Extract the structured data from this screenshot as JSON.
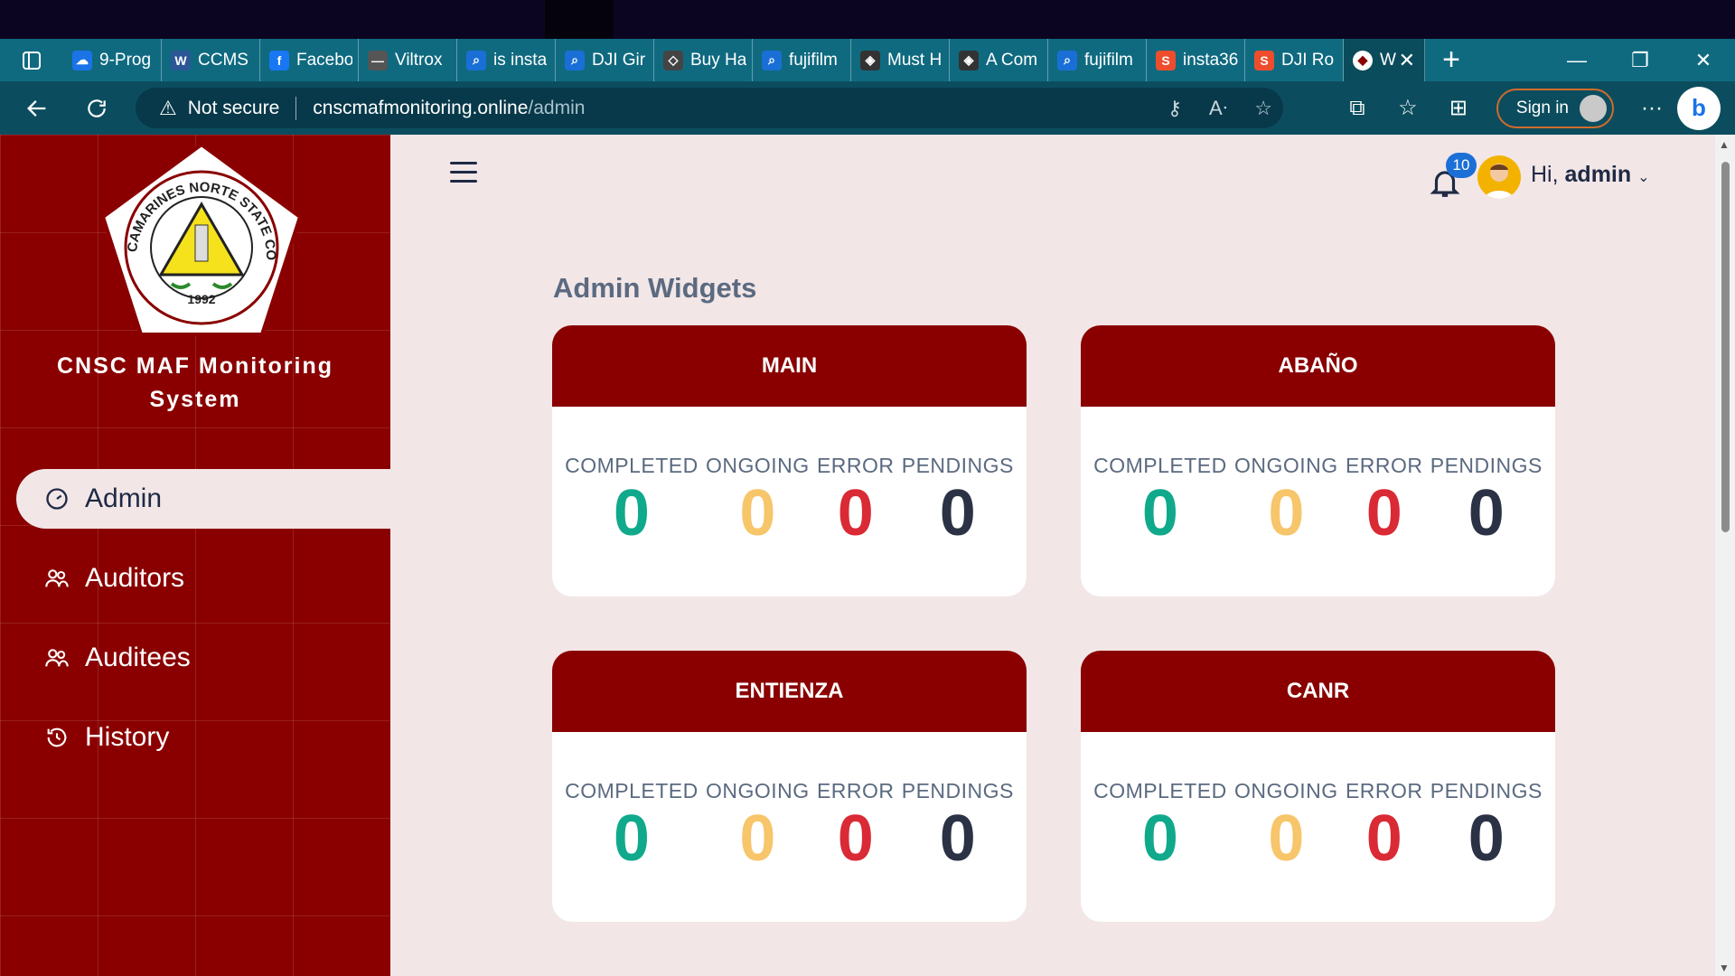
{
  "browser": {
    "tabs": [
      {
        "label": "9-Prog",
        "icon": "onedrive-icon",
        "color": "#1b73e8"
      },
      {
        "label": "CCMS",
        "icon": "word-icon",
        "color": "#2b5797"
      },
      {
        "label": "Facebo",
        "icon": "facebook-icon",
        "color": "#1877f2"
      },
      {
        "label": "Viltrox",
        "icon": "dash-icon",
        "color": "#555555"
      },
      {
        "label": "is insta",
        "icon": "search-icon",
        "color": "#1a6fd6"
      },
      {
        "label": "DJI Gir",
        "icon": "search-icon",
        "color": "#1a6fd6"
      },
      {
        "label": "Buy Ha",
        "icon": "dji-icon",
        "color": "#444444"
      },
      {
        "label": "fujifilm",
        "icon": "search-icon",
        "color": "#1a6fd6"
      },
      {
        "label": "Must H",
        "icon": "diamond-icon",
        "color": "#333333"
      },
      {
        "label": "A Com",
        "icon": "diamond-icon",
        "color": "#333333"
      },
      {
        "label": "fujifilm",
        "icon": "search-icon",
        "color": "#1a6fd6"
      },
      {
        "label": "insta36",
        "icon": "shopee-icon",
        "color": "#ee4d2d"
      },
      {
        "label": "DJI Ro",
        "icon": "shopee-icon",
        "color": "#ee4d2d"
      }
    ],
    "active_tab": {
      "label": "W",
      "icon": "college-seal-icon"
    },
    "address": {
      "security": "Not secure",
      "host": "cnscmafmonitoring.online",
      "path": "/admin"
    },
    "signin_label": "Sign in"
  },
  "sidebar": {
    "brand_line1": "CNSC MAF Monitoring",
    "brand_line2": "System",
    "logo": {
      "text": "CAMARINES NORTE STATE COLLEGE",
      "year": "1992"
    },
    "items": [
      {
        "label": "Admin",
        "icon": "dashboard-gauge-icon",
        "active": true
      },
      {
        "label": "Auditors",
        "icon": "users-icon",
        "active": false
      },
      {
        "label": "Auditees",
        "icon": "users-icon",
        "active": false
      },
      {
        "label": "History",
        "icon": "history-icon",
        "active": false
      }
    ]
  },
  "header": {
    "notification_count": "10",
    "greeting": "Hi,",
    "username": "admin"
  },
  "main": {
    "title": "Admin Widgets",
    "stat_labels": {
      "completed": "COMPLETED",
      "ongoing": "ONGOING",
      "error": "ERROR",
      "pendings": "PENDINGS"
    },
    "cards": [
      {
        "name": "MAIN",
        "completed": "0",
        "ongoing": "0",
        "error": "0",
        "pendings": "0"
      },
      {
        "name": "ABAÑO",
        "completed": "0",
        "ongoing": "0",
        "error": "0",
        "pendings": "0"
      },
      {
        "name": "ENTIENZA",
        "completed": "0",
        "ongoing": "0",
        "error": "0",
        "pendings": "0"
      },
      {
        "name": "CANR",
        "completed": "0",
        "ongoing": "0",
        "error": "0",
        "pendings": "0"
      }
    ]
  },
  "colors": {
    "brand": "#8a0000",
    "completed": "#10a98c",
    "ongoing": "#f7c56a",
    "error": "#d92a35",
    "pendings": "#2b3245"
  }
}
